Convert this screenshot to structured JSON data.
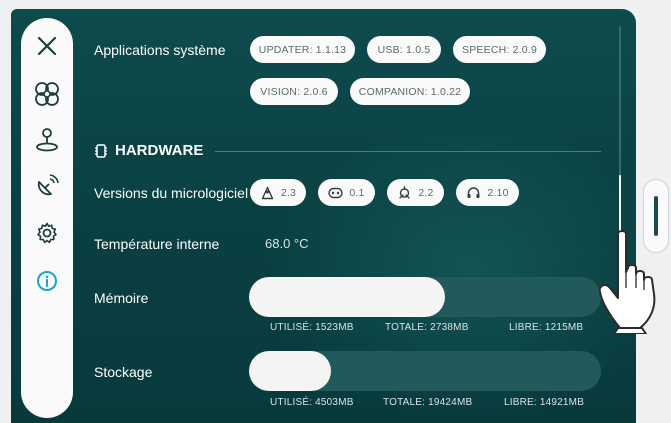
{
  "system_apps": {
    "label": "Applications système",
    "chips": [
      "UPDATER: 1.1.13",
      "USB: 1.0.5",
      "SPEECH: 2.0.9",
      "VISION: 2.0.6",
      "COMPANION: 1.0.22"
    ]
  },
  "hardware": {
    "title": "HARDWARE",
    "firmware_label": "Versions du micrologiciel",
    "firmware": [
      {
        "icon": "robot-body-icon",
        "version": "2.3"
      },
      {
        "icon": "robot-face-icon",
        "version": "0.1"
      },
      {
        "icon": "robot-arm-icon",
        "version": "2.2"
      },
      {
        "icon": "headset-icon",
        "version": "2.10"
      }
    ],
    "temperature_label": "Température interne",
    "temperature_value": "68.0 °C"
  },
  "memory": {
    "label": "Mémoire",
    "used": "UTILISÉ: 1523MB",
    "total": "TOTALE: 2738MB",
    "free": "LIBRE: 1215MB",
    "fraction_used": 0.556
  },
  "storage": {
    "label": "Stockage",
    "used": "UTILISÉ: 4503MB",
    "total": "TOTALE: 19424MB",
    "free": "LIBRE: 14921MB",
    "fraction_used": 0.232
  },
  "sidebar": {
    "items": [
      "close-icon",
      "fan-icon",
      "joystick-icon",
      "satellite-dish-icon",
      "gear-icon",
      "info-icon"
    ],
    "active": "info-icon",
    "accent": "#1aa7c7"
  },
  "colors": {
    "panel": "#0e4b4d",
    "chip_bg": "#fafafa",
    "chip_text": "#5b6a6b",
    "bar_fill": "#f4f4f2",
    "bar_track": "#22595a"
  }
}
